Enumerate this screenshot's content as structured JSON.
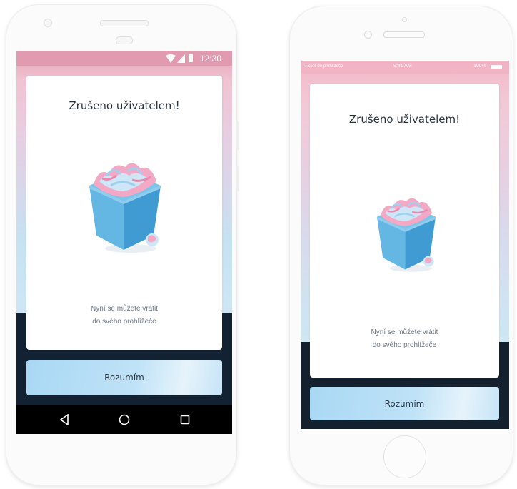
{
  "android": {
    "status_bar": {
      "time": "12:30"
    },
    "dialog": {
      "title": "Zrušeno uživatelem!",
      "message_line1": "Nyní se můžete vrátit",
      "message_line2": "do svého prohlížeče"
    },
    "confirm_button": "Rozumím",
    "nav_bar": {
      "back_icon": "back-triangle-icon",
      "home_icon": "home-circle-icon",
      "recents_icon": "recents-square-icon"
    }
  },
  "iphone": {
    "status_bar": {
      "back_link": "◂ Zpět do prohlížeče",
      "time": "9:41 AM",
      "battery": "100%"
    },
    "dialog": {
      "title": "Zrušeno uživatelem!",
      "message_line1": "Nyní se můžete vrátit",
      "message_line2": "do svého prohlížeče"
    },
    "confirm_button": "Rozumím"
  },
  "colors": {
    "accent_button": "#a9d8f4",
    "dark_footer": "#132233",
    "pink_top": "#e7a2b7"
  },
  "illustration": "gift-box-with-torn-paper"
}
